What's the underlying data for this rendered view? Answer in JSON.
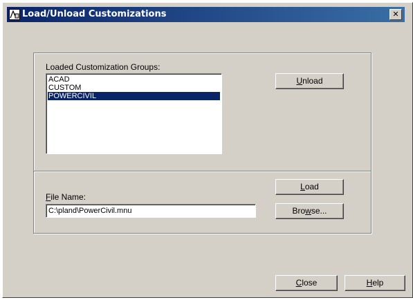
{
  "window": {
    "title": "Load/Unload Customizations",
    "close_glyph": "✕",
    "icon": "autocad-app-icon"
  },
  "loaded_groups": {
    "label": "Loaded Customization Groups:",
    "items": [
      "ACAD",
      "CUSTOM",
      "POWERCIVIL"
    ],
    "selected": "POWERCIVIL"
  },
  "file": {
    "label_prefix": "F",
    "label_rest": "ile Name:",
    "value": "C:\\pland\\PowerCivil.mnu"
  },
  "buttons": {
    "unload": {
      "u": "U",
      "rest": "nload"
    },
    "load": {
      "u": "L",
      "rest": "oad"
    },
    "browse": {
      "pre": "Bro",
      "u": "w",
      "rest": "se..."
    },
    "close": {
      "u": "C",
      "rest": "lose"
    },
    "help": {
      "u": "H",
      "rest": "elp"
    }
  },
  "colors": {
    "title_bar": "#0a246a",
    "dialog_face": "#d4d0c8",
    "selection": "#0a246a"
  }
}
